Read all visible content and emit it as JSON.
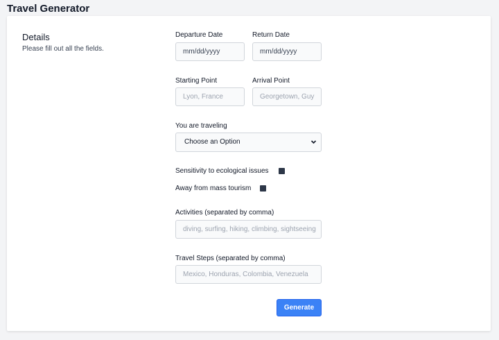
{
  "app": {
    "title": "Travel Generator"
  },
  "details": {
    "title": "Details",
    "description": "Please fill out all the fields."
  },
  "form": {
    "departure_date": {
      "label": "Departure Date",
      "value": "mm/dd/yyyy"
    },
    "return_date": {
      "label": "Return Date",
      "value": "mm/dd/yyyy"
    },
    "starting_point": {
      "label": "Starting Point",
      "placeholder": "Lyon, France"
    },
    "arrival_point": {
      "label": "Arrival Point",
      "placeholder": "Georgetown, Guy"
    },
    "traveling": {
      "label": "You are traveling",
      "selected": "Choose an Option",
      "chevron": "chevron-down-icon"
    },
    "eco_sensitivity": {
      "label": "Sensitivity to ecological issues"
    },
    "mass_tourism": {
      "label": "Away from mass tourism"
    },
    "activities": {
      "label": "Activities (separated by comma)",
      "placeholder": "diving, surfing, hiking, climbing, sightseeing"
    },
    "travel_steps": {
      "label": "Travel Steps (separated by comma)",
      "placeholder": "Mexico, Honduras, Colombia, Venezuela"
    },
    "submit_label": "Generate"
  },
  "colors": {
    "accent": "#3b82f6",
    "page_background": "#f3f4f6",
    "checkbox": "#2d3748"
  }
}
